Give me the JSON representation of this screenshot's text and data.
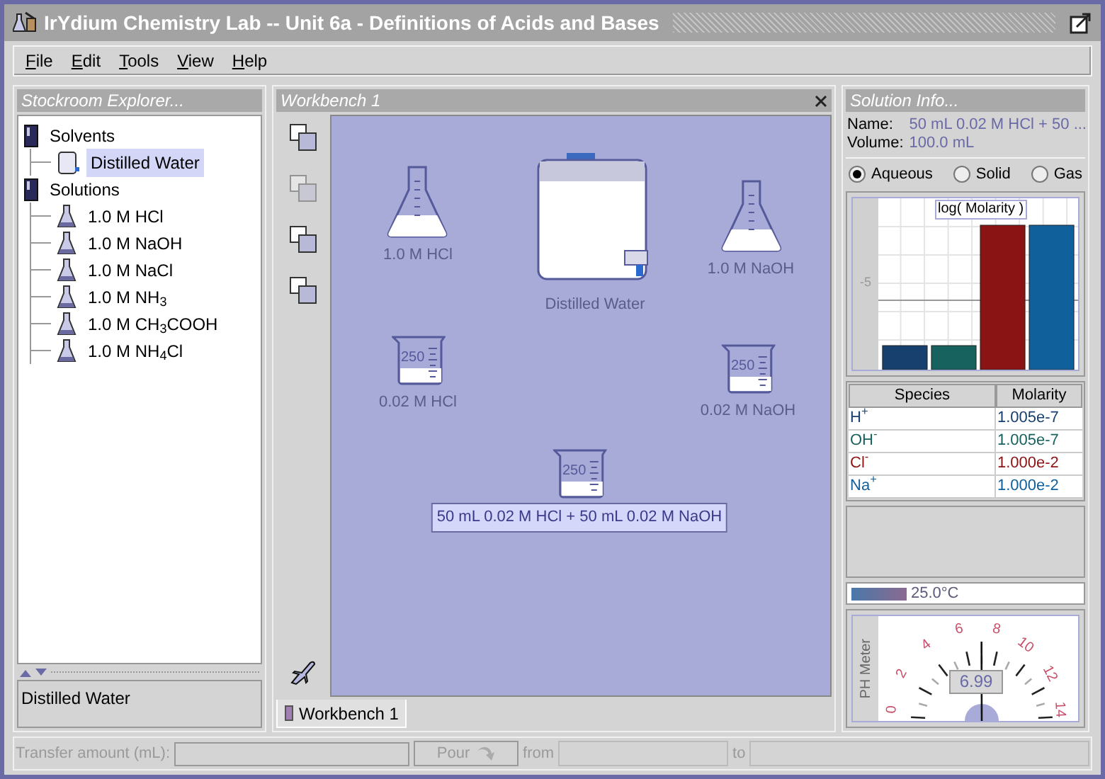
{
  "window": {
    "title": "IrYdium Chemistry Lab -- Unit 6a - Definitions of Acids and Bases"
  },
  "menu": [
    "File",
    "Edit",
    "Tools",
    "View",
    "Help"
  ],
  "stockroom": {
    "title": "Stockroom Explorer...",
    "tree": [
      {
        "label": "Solvents",
        "kind": "shelf",
        "selected": false,
        "children": [
          {
            "label": "Distilled Water",
            "kind": "carboy",
            "selected": true
          }
        ]
      },
      {
        "label": "Solutions",
        "kind": "shelf",
        "selected": false,
        "children": [
          {
            "label": "1.0 M HCl",
            "kind": "flask",
            "selected": false
          },
          {
            "label": "1.0 M NaOH",
            "kind": "flask",
            "selected": false
          },
          {
            "label": "1.0 M NaCl",
            "kind": "flask",
            "selected": false
          },
          {
            "label": "1.0 M NH$_{3}$",
            "kind": "flask",
            "selected": false
          },
          {
            "label": "1.0 M CH$_{3}$COOH",
            "kind": "flask",
            "selected": false
          },
          {
            "label": "1.0 M NH$_{4}$Cl",
            "kind": "flask",
            "selected": false
          }
        ]
      }
    ],
    "status": "Distilled Water"
  },
  "workbench": {
    "title": "Workbench 1",
    "items": [
      {
        "kind": "flask",
        "label": "1.0 M HCl",
        "selected": false
      },
      {
        "kind": "carboy",
        "label": "Distilled Water",
        "selected": false
      },
      {
        "kind": "flask",
        "label": "1.0 M NaOH",
        "selected": false
      },
      {
        "kind": "beaker",
        "label": "0.02 M HCl",
        "capacity": "250",
        "selected": false
      },
      {
        "kind": "beaker",
        "label": "0.02 M NaOH",
        "capacity": "250",
        "selected": false
      },
      {
        "kind": "beaker",
        "label": "50 mL 0.02 M HCl + 50 mL 0.02 M NaOH",
        "capacity": "250",
        "selected": true
      }
    ],
    "tabs": [
      {
        "label": "Workbench 1",
        "selected": true
      }
    ]
  },
  "solution_info": {
    "title": "Solution Info...",
    "name_label": "Name:",
    "name": "50 mL 0.02 M HCl + 50 ...",
    "volume_label": "Volume:",
    "volume": "100.0 mL",
    "phases": [
      {
        "label": "Aqueous",
        "selected": true
      },
      {
        "label": "Solid",
        "selected": false
      },
      {
        "label": "Gas",
        "selected": false
      }
    ],
    "chart": {
      "legend": "log( Molarity )",
      "tick": "-5"
    },
    "table": {
      "columns": [
        "Species",
        "Molarity"
      ],
      "rows": [
        {
          "species": "H$^{+}$",
          "molarity": "1.005e-7",
          "color": "#17406e"
        },
        {
          "species": "OH$^{-}$",
          "molarity": "1.005e-7",
          "color": "#17625e"
        },
        {
          "species": "Cl$^{-}$",
          "molarity": "1.000e-2",
          "color": "#8a1414"
        },
        {
          "species": "Na$^{+}$",
          "molarity": "1.000e-2",
          "color": "#10609c"
        }
      ]
    },
    "temperature": "25.0°C",
    "ph_meter": {
      "title": "PH Meter",
      "scale": [
        "0",
        "2",
        "4",
        "6",
        "8",
        "10",
        "12",
        "14"
      ],
      "reading": "6.99",
      "level": 0.499
    }
  },
  "transfer": {
    "amount_label": "Transfer amount (mL):",
    "pour_button": "Pour",
    "from_label": "from",
    "to_label": "to",
    "disabled": true
  }
}
